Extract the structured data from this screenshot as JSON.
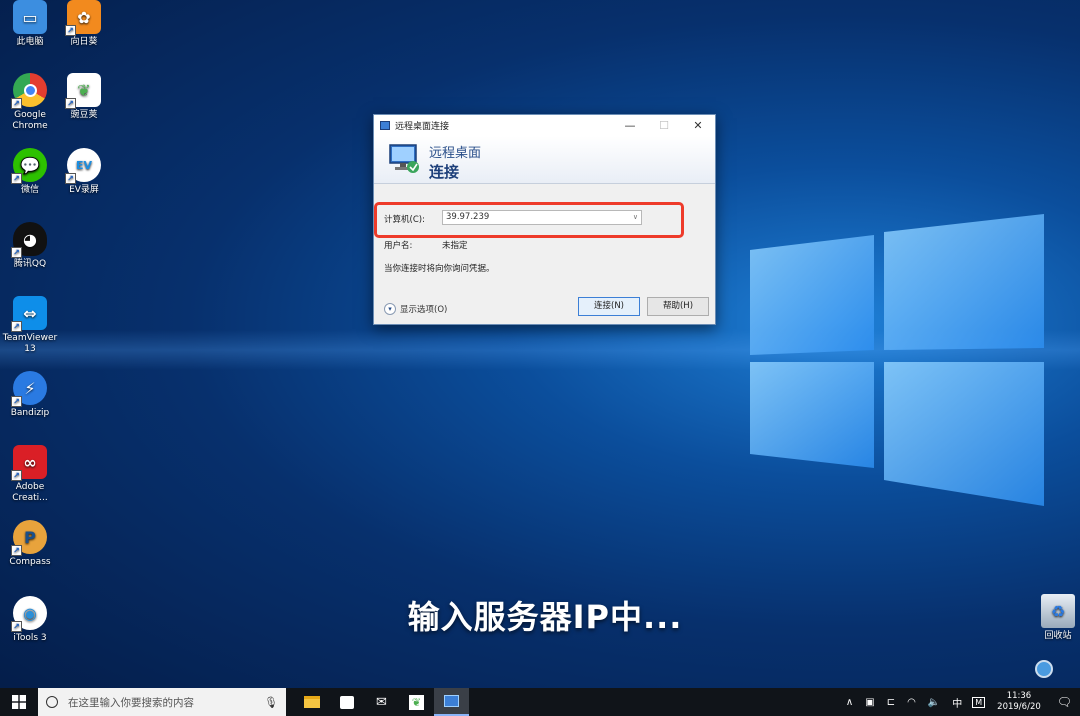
{
  "desktop": {
    "icons": [
      {
        "label": "此电脑",
        "icon": "computer-icon",
        "color": "#3c8ee0"
      },
      {
        "label": "向日葵",
        "icon": "sunflower-icon",
        "color": "#f28a1e"
      },
      {
        "label": "Google Chrome",
        "icon": "chrome-icon",
        "color": "#e33d2f"
      },
      {
        "label": "豌豆荚",
        "icon": "wandoujia-icon",
        "color": "#4caf50"
      },
      {
        "label": "微信",
        "icon": "wechat-icon",
        "color": "#2dc100"
      },
      {
        "label": "EV录屏",
        "icon": "ev-recorder-icon",
        "color": "#1b8de0"
      },
      {
        "label": "腾讯QQ",
        "icon": "qq-icon",
        "color": "#111111"
      },
      {
        "label": "TeamViewer 13",
        "icon": "teamviewer-icon",
        "color": "#0e8ee9"
      },
      {
        "label": "Bandizip",
        "icon": "bandizip-icon",
        "color": "#2a7ae2"
      },
      {
        "label": "Adobe Creati...",
        "icon": "adobe-cc-icon",
        "color": "#da1f26"
      },
      {
        "label": "Compass",
        "icon": "compass-icon",
        "color": "#e8a33c"
      },
      {
        "label": "iTools 3",
        "icon": "itools-icon",
        "color": "#2b8fd8"
      },
      {
        "label": "回收站",
        "icon": "recycle-bin-icon",
        "color": "#9ab"
      }
    ]
  },
  "dialog": {
    "title": "远程桌面连接",
    "banner_line1": "远程桌面",
    "banner_line2": "连接",
    "computer_label": "计算机(C):",
    "computer_value": "39.97.239",
    "username_label": "用户名:",
    "username_value": "未指定",
    "hint": "当你连接时将向你询问凭据。",
    "show_options": "显示选项(O)",
    "connect_button": "连接(N)",
    "help_button": "帮助(H)"
  },
  "caption": "输入服务器IP中...",
  "taskbar": {
    "search_placeholder": "在这里输入你要搜索的内容",
    "ime": "中",
    "ime_mode": "M",
    "time": "11:36",
    "date": "2019/6/20"
  },
  "colors": {
    "highlight": "#ee3b2a",
    "accent": "#3c7fd6"
  }
}
